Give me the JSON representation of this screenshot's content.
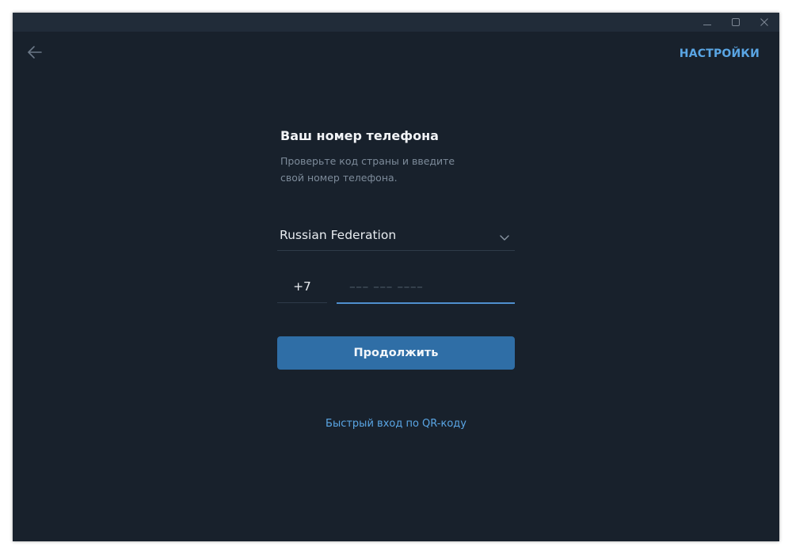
{
  "window": {
    "controls": [
      "minimize-icon",
      "maximize-icon",
      "close-icon"
    ]
  },
  "header": {
    "back_icon": "arrow-left-icon",
    "settings_label": "НАСТРОЙКИ"
  },
  "form": {
    "title": "Ваш номер телефона",
    "description_line1": "Проверьте код страны и введите",
    "description_line2": "свой номер телефона.",
    "country": {
      "selected": "Russian Federation",
      "icon": "chevron-down-icon"
    },
    "country_code": {
      "value": "+7"
    },
    "phone": {
      "value": "",
      "placeholder": "––– ––– ––––"
    },
    "continue_label": "Продолжить",
    "qr_link": "Быстрый вход по QR-коду"
  },
  "colors": {
    "background": "#18212c",
    "titlebar": "#212c39",
    "accent": "#5aa6e5",
    "button": "#2f6ea6",
    "input_active_border": "#4f8fcf"
  }
}
